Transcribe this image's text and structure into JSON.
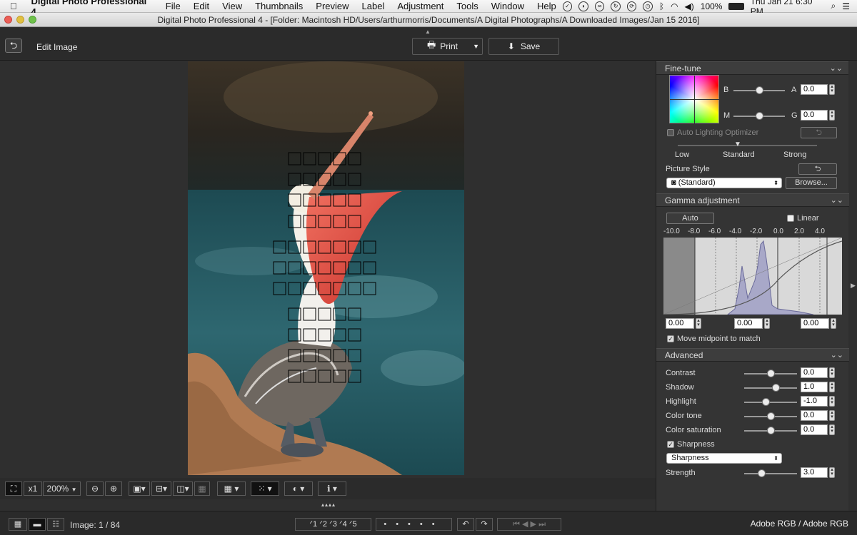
{
  "menubar": {
    "app": "Digital Photo Professional 4",
    "menus": [
      "File",
      "Edit",
      "View",
      "Thumbnails",
      "Preview",
      "Label",
      "Adjustment",
      "Tools",
      "Window",
      "Help"
    ],
    "battery": "100%",
    "clock": "Thu Jan 21  6:30 PM"
  },
  "window": {
    "title": "Digital Photo Professional 4 - [Folder: Macintosh HD/Users/arthurmorris/Documents/A Digital Photographs/A Downloaded Images/Jan 15 2016]"
  },
  "toolbar": {
    "edit_title": "Edit Image",
    "print_label": "Print",
    "save_label": "Save"
  },
  "finetune": {
    "title": "Fine-tune",
    "axis_b": "B",
    "axis_a": "A",
    "axis_m": "M",
    "axis_g": "G",
    "ba_value": "0.0",
    "mg_value": "0.0",
    "alo_label": "Auto Lighting Optimizer",
    "alo_low": "Low",
    "alo_standard": "Standard",
    "alo_strong": "Strong",
    "picture_style_label": "Picture Style",
    "picture_style_value": "(Standard)",
    "browse_label": "Browse..."
  },
  "gamma": {
    "title": "Gamma adjustment",
    "auto_label": "Auto",
    "linear_label": "Linear",
    "scale": [
      "-10.0",
      "-8.0",
      "-6.0",
      "-4.0",
      "-2.0",
      "0.0",
      "2.0",
      "4.0"
    ],
    "input_left": "0.00",
    "input_mid": "0.00",
    "input_right": "0.00",
    "midpoint_label": "Move midpoint to match"
  },
  "advanced": {
    "title": "Advanced",
    "rows": [
      {
        "label": "Contrast",
        "value": "0.0"
      },
      {
        "label": "Shadow",
        "value": "1.0"
      },
      {
        "label": "Highlight",
        "value": "-1.0"
      },
      {
        "label": "Color tone",
        "value": "0.0"
      },
      {
        "label": "Color saturation",
        "value": "0.0"
      }
    ],
    "sharpness_label": "Sharpness",
    "sharpness_mode": "Sharpness",
    "strength_label": "Strength",
    "strength_value": "3.0"
  },
  "bottom": {
    "zoom_x1": "x1",
    "zoom_value": "200%"
  },
  "status": {
    "image_count": "Image: 1 / 84",
    "ratings": [
      "1",
      "2",
      "3",
      "4",
      "5"
    ],
    "color_space": "Adobe RGB / Adobe RGB"
  }
}
